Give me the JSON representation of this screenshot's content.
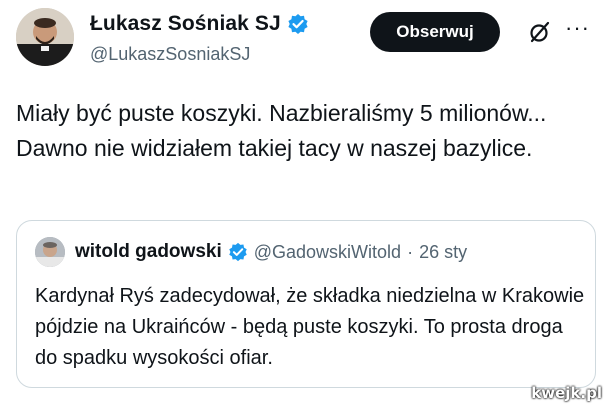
{
  "author": {
    "display_name": "Łukasz Sośniak SJ",
    "handle": "@LukaszSosniakSJ",
    "verified_icon": "verified-badge-icon"
  },
  "actions": {
    "follow_label": "Obserwuj",
    "grok_icon": "grok-icon",
    "more_label": "···"
  },
  "tweet": {
    "text": "Miały być puste koszyki. Nazbieraliśmy 5 milionów... Dawno nie widziałem takiej tacy w naszej bazylice."
  },
  "quoted_tweet": {
    "display_name": "witold gadowski",
    "handle": "@GadowskiWitold",
    "separator": "·",
    "date": "26 sty",
    "text": "Kardynał Ryś zadecydował, że składka niedzielna w Krakowie pójdzie na Ukraińców - będą puste koszyki. To prosta droga do spadku wysokości ofiar."
  },
  "watermark": "kwejk.pl",
  "colors": {
    "verified_blue": "#1d9bf0",
    "text_primary": "#0f1419",
    "text_secondary": "#536471",
    "border": "#cfd9de",
    "button_bg": "#0f1419"
  }
}
